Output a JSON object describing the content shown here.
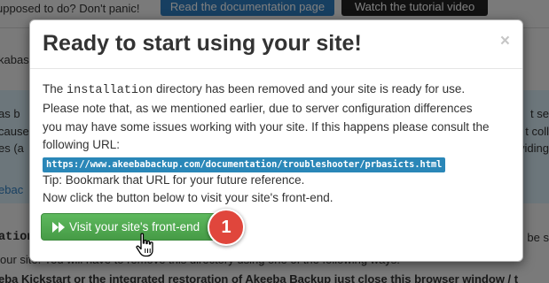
{
  "background": {
    "top_question": "upposed to do? Don't panic!",
    "doc_button_label": "Read the documentation page",
    "video_button_label": "Watch the tutorial video",
    "fragment_left_1": "kabas",
    "fragment_left_2": "as b",
    "fragment_left_3": "cause",
    "fragment_left_4": "es (a",
    "fragment_left_5": "ebac",
    "fragment_left_6": "ation",
    "fragment_right_1": "t se",
    "fragment_right_2": "t coll",
    "fragment_right_3": "viding",
    "fragment_right_4": "be s",
    "bottom_line_1": "our site. You will have to remove this directory using one of the following ways:",
    "bottom_line_2": "eba Kickstart or the integrated restoration of Akeeba Backup just close this browser window / t"
  },
  "modal": {
    "title": "Ready to start using your site!",
    "close_symbol": "×",
    "para1_pre": "The ",
    "para1_code": "installation",
    "para1_post": " directory has been removed and your site is ready for use.",
    "para2_line1": "Please note that, as we mentioned earlier, due to server configuration differences",
    "para2_line2": "you may have some issues working with your site. If this happens please consult the",
    "para2_line3": "following URL:",
    "url": "https://www.akeebabackup.com/documentation/troubleshooter/prbasicts.html",
    "tip": "Tip: Bookmark that URL for your future reference.",
    "instruction": "Now click the button below to visit your site's front-end.",
    "visit_button_label": "Visit your site's front-end",
    "play_icon": "fast-forward-icon"
  },
  "annotation": {
    "step_number": "1",
    "badge_color": "#e0463c",
    "cursor_icon": "hand-pointer-icon"
  },
  "colors": {
    "button_green": "#5eb95e",
    "url_highlight": "#2a87b8",
    "doc_button_blue": "#2f7fc2"
  }
}
